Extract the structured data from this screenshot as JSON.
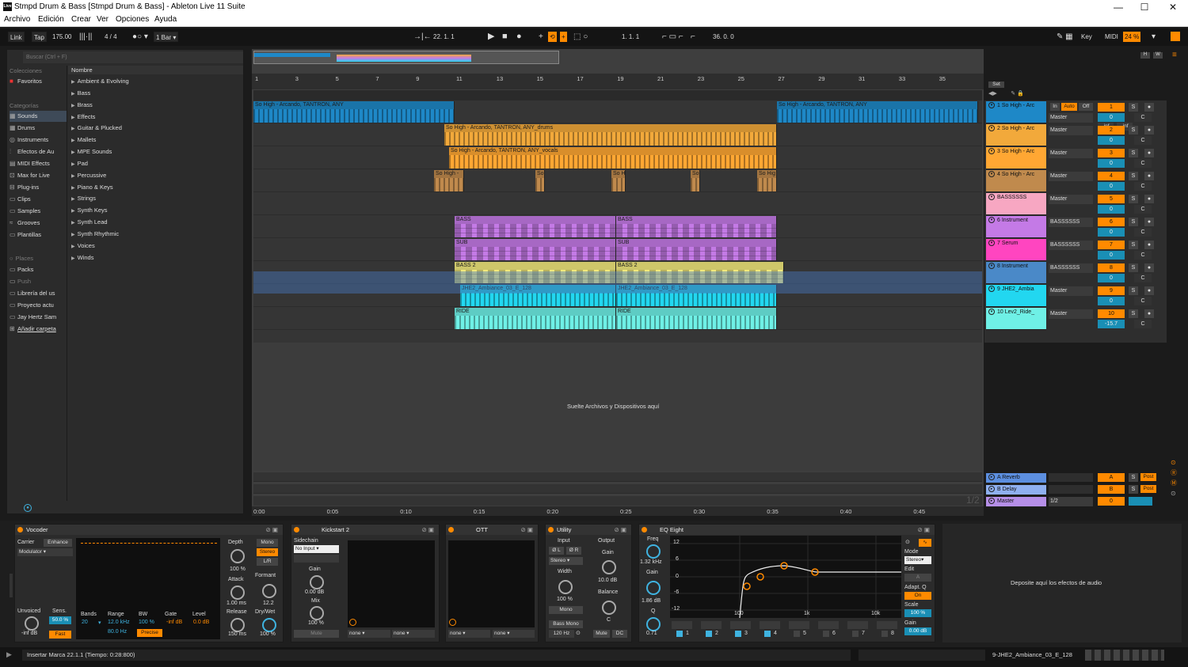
{
  "window": {
    "title": "Stmpd Drum & Bass  [Stmpd Drum & Bass] - Ableton Live 11 Suite",
    "logo": "Live",
    "minimize": "—",
    "maximize": "☐",
    "close": "✕"
  },
  "menu": [
    "Archivo",
    "Edición",
    "Crear",
    "Ver",
    "Opciones",
    "Ayuda"
  ],
  "toolbar": {
    "link": "Link",
    "tap": "Tap",
    "tempo": "175.00",
    "sig": "4 / 4",
    "quant": "1 Bar",
    "position": "22.  1.  1",
    "loop_start": "1.  1.  1",
    "loop_len": "36.  0.  0",
    "key": "Key",
    "midi": "MIDI",
    "cpu": "24 %"
  },
  "browser": {
    "search_placeholder": "Buscar (Ctrl + F)",
    "collections": "Colecciones",
    "favorites": "Favoritos",
    "categories": "Categorías",
    "places": "Places",
    "cats": [
      "Sounds",
      "Drums",
      "Instruments",
      "Efectos de Au",
      "MIDI Effects",
      "Max for Live",
      "Plug-ins",
      "Clips",
      "Samples",
      "Grooves",
      "Plantillas"
    ],
    "places_items": [
      "Packs",
      "Push",
      "Librería del us",
      "Proyecto actu",
      "Jay Hertz Sam",
      "Añadir carpeta"
    ],
    "name_header": "Nombre",
    "items": [
      "Ambient & Evolving",
      "Bass",
      "Brass",
      "Effects",
      "Guitar & Plucked",
      "Mallets",
      "MPE Sounds",
      "Pad",
      "Percussive",
      "Piano & Keys",
      "Strings",
      "Synth Keys",
      "Synth Lead",
      "Synth Rhythmic",
      "Voices",
      "Winds"
    ]
  },
  "ruler": [
    "1",
    "3",
    "5",
    "7",
    "9",
    "11",
    "13",
    "15",
    "17",
    "19",
    "21",
    "23",
    "25",
    "27",
    "29",
    "31",
    "33",
    "35"
  ],
  "time": [
    "0:00",
    "0:05",
    "0:10",
    "0:15",
    "0:20",
    "0:25",
    "0:30",
    "0:35",
    "0:40",
    "0:45"
  ],
  "set_label": "Set",
  "drop_hint": "Suelte Archivos y Dispositivos aquí",
  "tracks": [
    {
      "name": "1 So High - Arc",
      "color": "#1e88c7",
      "io": "Master",
      "num": "1",
      "vol": "0",
      "pan": "C",
      "extra": "-inf",
      "extra2": "-inf",
      "in": "In",
      "auto": "Auto",
      "off": "Off"
    },
    {
      "name": "2 So High - Arc",
      "color": "#f2a93b",
      "io": "Master",
      "num": "2",
      "vol": "0",
      "pan": "C"
    },
    {
      "name": "3 So High - Arc",
      "color": "#ffa733",
      "io": "Master",
      "num": "3",
      "vol": "0",
      "pan": "C"
    },
    {
      "name": "4 So High - Arc",
      "color": "#c08a4d",
      "io": "Master",
      "num": "4",
      "vol": "0",
      "pan": "C"
    },
    {
      "name": "BASSSSSS",
      "color": "#f7a7c2",
      "io": "Master",
      "num": "5",
      "vol": "0",
      "pan": "C"
    },
    {
      "name": "6 Instrument",
      "color": "#c47ae6",
      "io": "BASSSSSS",
      "num": "6",
      "vol": "0",
      "pan": "C"
    },
    {
      "name": "7 Serum",
      "color": "#ff45c0",
      "io": "BASSSSSS",
      "num": "7",
      "vol": "0",
      "pan": "C"
    },
    {
      "name": "8 Instrument",
      "color": "#4a89c8",
      "io": "BASSSSSS",
      "num": "8",
      "vol": "0",
      "pan": "C"
    },
    {
      "name": "9 JHE2_Ambia",
      "color": "#22d7f0",
      "io": "Master",
      "num": "9",
      "vol": "0",
      "pan": "C"
    },
    {
      "name": "10 Lev2_Ride_",
      "color": "#6ff0e6",
      "io": "Master",
      "num": "10",
      "vol": "-15.7",
      "pan": "C"
    }
  ],
  "clips": [
    {
      "name": "So High - Arcando, TANTRON, ANY",
      "lane": 0,
      "start": 0,
      "width": 254,
      "color": "#1e88c7",
      "midi": false
    },
    {
      "name": "So High - Arcando, TANTRON, ANY",
      "lane": 0,
      "start": 661,
      "width": 254,
      "color": "#1e88c7",
      "midi": false
    },
    {
      "name": "So High - Arcando, TANTRON, ANY_drums",
      "lane": 1,
      "start": 241,
      "width": 420,
      "color": "#f2a93b",
      "midi": false
    },
    {
      "name": "So High - Arcando, TANTRON, ANY_vocals",
      "lane": 2,
      "start": 247,
      "width": 414,
      "color": "#ffa733",
      "midi": false
    },
    {
      "name": "So High -",
      "lane": 3,
      "start": 228,
      "width": 38,
      "color": "#c08a4d",
      "midi": false
    },
    {
      "name": "So",
      "lane": 3,
      "start": 356,
      "width": 12,
      "color": "#c08a4d",
      "midi": false
    },
    {
      "name": "So H",
      "lane": 3,
      "start": 452,
      "width": 18,
      "color": "#c08a4d",
      "midi": false
    },
    {
      "name": "So",
      "lane": 3,
      "start": 552,
      "width": 12,
      "color": "#c08a4d",
      "midi": false
    },
    {
      "name": "So Hig",
      "lane": 3,
      "start": 636,
      "width": 25,
      "color": "#c08a4d",
      "midi": false
    },
    {
      "name": "BASS",
      "lane": 5,
      "start": 254,
      "width": 204,
      "color": "#c47ae6",
      "midi": true
    },
    {
      "name": "BASS",
      "lane": 5,
      "start": 458,
      "width": 203,
      "color": "#c47ae6",
      "midi": true
    },
    {
      "name": "SUB",
      "lane": 6,
      "start": 254,
      "width": 204,
      "color": "#c47ae6",
      "midi": true
    },
    {
      "name": "SUB",
      "lane": 6,
      "start": 458,
      "width": 203,
      "color": "#c47ae6",
      "midi": true
    },
    {
      "name": "BASS 2",
      "lane": 7,
      "start": 254,
      "width": 204,
      "color": "#f2ea7d",
      "midi": true
    },
    {
      "name": "BASS 2",
      "lane": 7,
      "start": 458,
      "width": 212,
      "color": "#f2ea7d",
      "midi": true
    },
    {
      "name": "JHE2_Ambiance_03_E_128",
      "lane": 8,
      "start": 261,
      "width": 197,
      "color": "#22d7f0",
      "midi": false
    },
    {
      "name": "JHE2_Ambiance_03_E_128",
      "lane": 8,
      "start": 458,
      "width": 203,
      "color": "#22d7f0",
      "midi": false
    },
    {
      "name": "RIDE",
      "lane": 9,
      "start": 254,
      "width": 204,
      "color": "#6ff0e6",
      "midi": false
    },
    {
      "name": "RIDE",
      "lane": 9,
      "start": 458,
      "width": 203,
      "color": "#6ff0e6",
      "midi": false
    }
  ],
  "returns": [
    {
      "name": "A Reverb",
      "color": "#5c8fe0",
      "num": "A",
      "post": "Post"
    },
    {
      "name": "B Delay",
      "color": "#8fb0f0",
      "num": "B",
      "post": "Post"
    },
    {
      "name": "Master",
      "color": "#b68fe8",
      "num": "0",
      "io": "1/2"
    }
  ],
  "page_marker": "1/2",
  "devices": {
    "vocoder": {
      "title": "Vocoder",
      "carrier": "Carrier",
      "enhance": "Enhance",
      "modulator": "Modulator",
      "depth": "Depth",
      "depth_val": "100 %",
      "mono": "Mono",
      "stereo": "Stereo",
      "lr": "L/R",
      "attack": "Attack",
      "attack_val": "1.00 ms",
      "formant": "Formant",
      "formant_val": "12.2",
      "release": "Release",
      "release_val": "150 ms",
      "drywet": "Dry/Wet",
      "drywet_val": "100 %",
      "unvoiced": "Unvoiced",
      "unvoiced_val": "-inf dB",
      "sens": "Sens.",
      "sens_val": "50.0 %",
      "fast": "Fast",
      "bands": "Bands",
      "bands_val": "20",
      "range": "Range",
      "range_val": "12.0 kHz",
      "range_val2": "80.0 Hz",
      "bw": "BW",
      "bw_val": "100 %",
      "precise": "Precise",
      "gate": "Gate",
      "gate_val": "-inf dB",
      "level": "Level",
      "level_val": "0.0 dB"
    },
    "kickstart": {
      "title": "Kickstart 2",
      "sidechain": "Sidechain",
      "input": "No Input",
      "gain": "Gain",
      "gain_val": "0.00 dB",
      "mix": "Mix",
      "mix_val": "100 %",
      "mute": "Mute",
      "none1": "none",
      "none2": "none"
    },
    "ott": {
      "title": "OTT",
      "none1": "none",
      "none2": "none"
    },
    "utility": {
      "title": "Utility",
      "input": "Input",
      "output": "Output",
      "phl": "Ø L",
      "phr": "Ø R",
      "stereo": "Stereo",
      "gain": "Gain",
      "gain_val": "10.0 dB",
      "width": "Width",
      "width_val": "100 %",
      "balance": "Balance",
      "balance_val": "C",
      "mono": "Mono",
      "bassmono": "Bass Mono",
      "bass_hz": "120 Hz",
      "mute": "Mute",
      "dc": "DC"
    },
    "eq": {
      "title": "EQ Eight",
      "freq": "Freq",
      "freq_val": "1.32 kHz",
      "gain": "Gain",
      "gain_val": "1.86 dB",
      "q": "Q",
      "q_val": "0.71",
      "db": [
        "12",
        "6",
        "0",
        "-6",
        "-12"
      ],
      "fx": [
        "100",
        "1k",
        "10k"
      ],
      "mode": "Mode",
      "mode_val": "Stereo",
      "edit": "Edit",
      "edit_val": "A",
      "adapt": "Adapt. Q",
      "adapt_val": "On",
      "scale": "Scale",
      "scale_val": "100 %",
      "gain2": "Gain",
      "gain2_val": "0.00 dB",
      "bands": [
        "1",
        "2",
        "3",
        "4",
        "5",
        "6",
        "7",
        "8"
      ]
    },
    "drop_hint": "Deposite aquí los efectos de audio"
  },
  "status": {
    "text": "Insertar Marca 22.1.1 (Tiempo: 0:28:800)",
    "track": "9-JHE2_Ambiance_03_E_128"
  }
}
